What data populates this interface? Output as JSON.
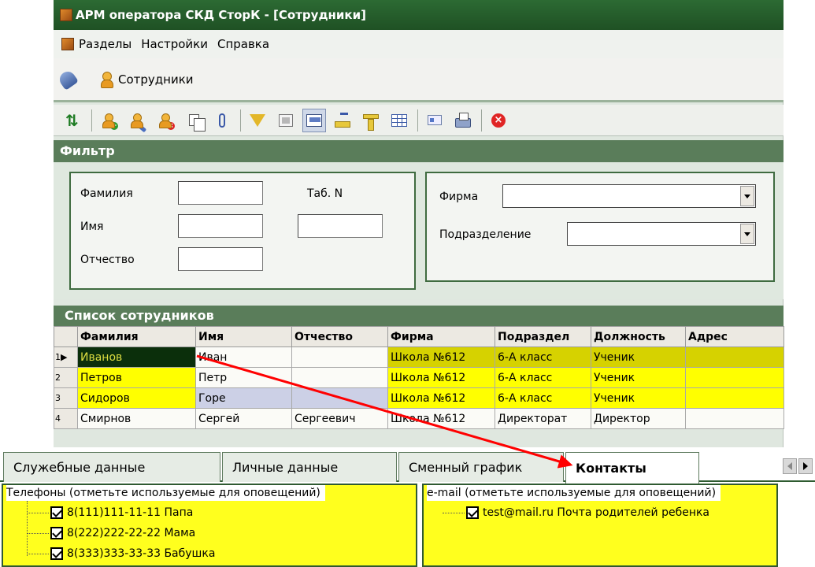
{
  "window": {
    "title": "АРМ оператора СКД СторК - [Сотрудники]"
  },
  "menu": {
    "items": [
      "Разделы",
      "Настройки",
      "Справка"
    ]
  },
  "navbar": {
    "section_label": "Сотрудники"
  },
  "toolbar": {
    "icons": [
      "refresh-arrows-icon",
      "add-employee-icon",
      "edit-employee-icon",
      "delete-employee-icon",
      "copy-icon",
      "attachment-icon",
      "filter-icon",
      "form-view-icon",
      "screen-view-icon",
      "ruler-icon",
      "tee-ruler-icon",
      "table-view-icon",
      "id-card-icon",
      "print-icon",
      "close-icon"
    ]
  },
  "filter": {
    "title": "Фильтр",
    "lastname_label": "Фамилия",
    "firstname_label": "Имя",
    "middlename_label": "Отчество",
    "tabnum_label": "Таб. N",
    "lastname_value": "",
    "firstname_value": "",
    "middlename_value": "",
    "tabnum_value": "",
    "firm_label": "Фирма",
    "firm_value": "",
    "department_label": "Подразделение",
    "department_value": ""
  },
  "employees": {
    "title": "Список сотрудников",
    "columns": [
      "Фамилия",
      "Имя",
      "Отчество",
      "Фирма",
      "Подраздел",
      "Должность",
      "Адрес"
    ],
    "rows": [
      {
        "num": "1",
        "cells": [
          "Иванов",
          "Иван",
          "",
          "Школа №612",
          "6-А класс",
          "Ученик",
          ""
        ]
      },
      {
        "num": "2",
        "cells": [
          "Петров",
          "Петр",
          "",
          "Школа №612",
          "6-А класс",
          "Ученик",
          ""
        ]
      },
      {
        "num": "3",
        "cells": [
          "Сидоров",
          "Горе",
          "",
          "Школа №612",
          "6-А класс",
          "Ученик",
          ""
        ]
      },
      {
        "num": "4",
        "cells": [
          "Смирнов",
          "Сергей",
          "Сергеевич",
          "Школа №612",
          "Директорат",
          "Директор",
          ""
        ]
      }
    ]
  },
  "tabs": {
    "items": [
      "Служебные данные",
      "Личные данные",
      "Сменный график",
      "Контакты"
    ],
    "active": "Контакты"
  },
  "contacts": {
    "phones_title": "Телефоны (отметьте используемые для оповещений)",
    "phones": [
      "8(111)111-11-11 Папа",
      "8(222)222-22-22 Мама",
      "8(333)333-33-33 Бабушка"
    ],
    "email_title": "e-mail (отметьте используемые для оповещений)",
    "emails": [
      "test@mail.ru Почта родителей ребенка"
    ]
  },
  "colors": {
    "accent_green": "#5a7d5a",
    "title_green": "#2c6a33",
    "highlight_yellow": "#ffff00",
    "annotation_red": "#ff0000"
  }
}
